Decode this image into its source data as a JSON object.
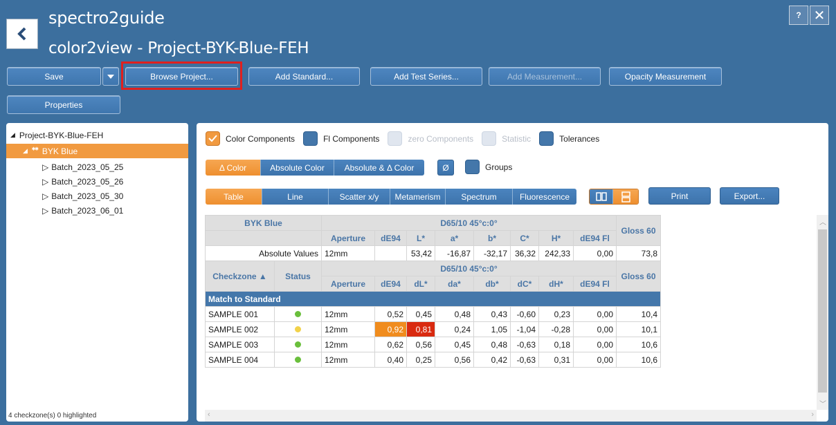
{
  "app": {
    "title": "spectro2guide",
    "subtitle": "color2view - Project-BYK-Blue-FEH",
    "help": "?",
    "close": "✕"
  },
  "toolbar": {
    "save": "Save",
    "browse": "Browse Project...",
    "add_standard": "Add Standard...",
    "add_test_series": "Add Test Series...",
    "add_measurement": "Add Measurement...",
    "opacity": "Opacity Measurement",
    "properties": "Properties"
  },
  "tree": {
    "project": "Project-BYK-Blue-FEH",
    "standard": "BYK Blue",
    "batches": [
      "Batch_2023_05_25",
      "Batch_2023_05_26",
      "Batch_2023_05_30",
      "Batch_2023_06_01"
    ],
    "status": "4 checkzone(s) 0 highlighted"
  },
  "options": {
    "color_components": "Color Components",
    "fl_components": "Fl Components",
    "zero_components": "zero Components",
    "statistic": "Statistic",
    "tolerances": "Tolerances",
    "groups": "Groups",
    "avg": "Ø"
  },
  "mode_tabs": [
    "Δ Color",
    "Absolute Color",
    "Absolute & Δ Color"
  ],
  "view_tabs": [
    "Table",
    "Line",
    "Scatter x/y",
    "Metamerism",
    "Spectrum",
    "Fluorescence"
  ],
  "actions": {
    "print": "Print",
    "export": "Export..."
  },
  "table": {
    "std_name": "BYK Blue",
    "illum": "D65/10  45°c:0°",
    "gloss": "Gloss 60",
    "abs_headers": [
      "Aperture",
      "dE94",
      "L*",
      "a*",
      "b*",
      "C*",
      "H*",
      "dE94 Fl"
    ],
    "abs_label": "Absolute Values",
    "abs_values": [
      "12mm",
      "",
      "53,42",
      "-16,87",
      "-32,17",
      "36,32",
      "242,33",
      "0,00",
      "73,8"
    ],
    "col_checkzone": "Checkzone ▲",
    "col_status": "Status",
    "delta_headers": [
      "Aperture",
      "dE94",
      "dL*",
      "da*",
      "db*",
      "dC*",
      "dH*",
      "dE94 Fl"
    ],
    "group": "Match to Standard",
    "rows": [
      {
        "name": "SAMPLE 001",
        "status": "#6abf3c",
        "cells": [
          "12mm",
          "0,52",
          "0,45",
          "0,48",
          "0,43",
          "-0,60",
          "0,23",
          "0,00",
          "10,4"
        ]
      },
      {
        "name": "SAMPLE 002",
        "status": "#f2d24a",
        "cells": [
          "12mm",
          "0,92",
          "0,81",
          "0,24",
          "1,05",
          "-1,04",
          "-0,28",
          "0,00",
          "10,1"
        ]
      },
      {
        "name": "SAMPLE 003",
        "status": "#6abf3c",
        "cells": [
          "12mm",
          "0,62",
          "0,56",
          "0,45",
          "0,48",
          "-0,63",
          "0,18",
          "0,00",
          "10,6"
        ]
      },
      {
        "name": "SAMPLE 004",
        "status": "#6abf3c",
        "cells": [
          "12mm",
          "0,40",
          "0,25",
          "0,56",
          "0,42",
          "-0,63",
          "0,31",
          "0,00",
          "10,6"
        ]
      }
    ]
  },
  "colors": {
    "accent": "#f19a40",
    "primary": "#4477aa",
    "warn_orange": "#f08c1e",
    "warn_red": "#d92a10",
    "highlight_box": "#e0201e"
  }
}
